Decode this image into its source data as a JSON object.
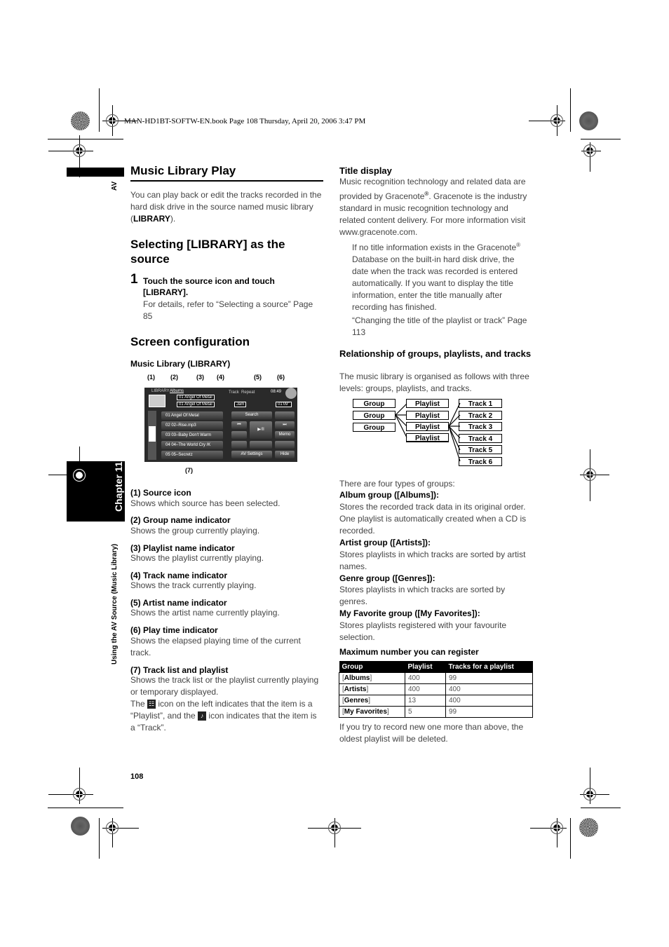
{
  "header_meta": "MAN-HD1BT-SOFTW-EN.book  Page 108  Thursday, April 20, 2006  3:47 PM",
  "side_labels": {
    "section": "AV",
    "chapter": "Chapter 11",
    "running_title": "Using the AV Source (Music Library)"
  },
  "left": {
    "title": "Music Library Play",
    "intro_pre": "You can play back or edit the tracks recorded in the hard disk drive in the source named music library (",
    "intro_bold": "LIBRARY",
    "intro_post": ").",
    "selecting_heading": "Selecting [LIBRARY] as the source",
    "step_number": "1",
    "step_text": "Touch the source icon and touch [LIBRARY].",
    "step_detail": "For details, refer to “Selecting a source” Page 85",
    "screen_heading": "Screen configuration",
    "figure_caption": "Music Library (LIBRARY)",
    "callouts": [
      "(1)",
      "(2)",
      "(3)",
      "(4)",
      "(5)",
      "(6)",
      "(7)"
    ],
    "screen": {
      "source_label": "LIBRARY",
      "group": "Albums",
      "playlist": "01 Angel Of Metal",
      "track": "01 Angel Of Metal",
      "mode_track": "Track",
      "mode_repeat": "Repeat",
      "clock": "08:49",
      "artist": "Jam",
      "time": "01'09\"",
      "tracks": [
        "01 Angel Of Metal",
        "02 02–Rise.mp3",
        "03 03–Baby Don't Warm",
        "04 04–The World Cry /K",
        "05 05–Secretz"
      ],
      "buttons": {
        "search": "Search",
        "play_pause": "▶/II",
        "prev": "⏮",
        "next": "⏭",
        "memo": "Memo",
        "av_settings": "AV Settings",
        "hide": "Hide"
      }
    },
    "items": [
      {
        "title": "(1) Source icon",
        "desc": "Shows which source has been selected."
      },
      {
        "title": "(2) Group name indicator",
        "desc": "Shows the group currently playing."
      },
      {
        "title": "(3) Playlist name indicator",
        "desc": "Shows the playlist currently playing."
      },
      {
        "title": "(4) Track name indicator",
        "desc": "Shows the track currently playing."
      },
      {
        "title": "(5) Artist name indicator",
        "desc": "Shows the artist name currently playing."
      },
      {
        "title": "(6) Play time indicator",
        "desc": "Shows the elapsed playing time of the current track."
      },
      {
        "title": "(7) Track list and playlist",
        "desc": "Shows the track list or the playlist currently playing or temporary displayed."
      }
    ],
    "icon_note_1": "The",
    "icon_note_2": "icon on the left indicates that the item is a “Playlist”, and the",
    "icon_note_3": "icon indicates that the item is a “Track”.",
    "page_number": "108"
  },
  "right": {
    "title_display_heading": "Title display",
    "title_display_pre": "Music recognition technology and related data are provided by Gracenote",
    "title_display_post": ". Gracenote is the industry standard in music recognition technology and related content delivery. For more information visit www.gracenote.com.",
    "note_pre": "If no title information exists in the Gracenote",
    "note_post": " Database on the built-in hard disk drive, the date when the track was recorded is entered automatically. If you want to display the title information, enter the title manually after recording has finished.",
    "ref": "“Changing the title of the playlist or track” Page 113",
    "relationship_heading": "Relationship of groups, playlists, and tracks",
    "relationship_text": "The music library is organised as follows with three levels: groups, playlists, and tracks.",
    "diagram": {
      "groups": [
        "Group",
        "Group",
        "Group"
      ],
      "playlists": [
        "Playlist",
        "Playlist",
        "Playlist",
        "Playlist"
      ],
      "tracks": [
        "Track 1",
        "Track 2",
        "Track 3",
        "Track 4",
        "Track 5",
        "Track 6"
      ]
    },
    "four_types": "There are four types of groups:",
    "groups": [
      {
        "title": "Album group ([Albums]):",
        "desc": "Stores the recorded track data in its original order. One playlist is automatically created when a CD is recorded."
      },
      {
        "title": "Artist group ([Artists]):",
        "desc": "Stores playlists in which tracks are sorted by artist names."
      },
      {
        "title": "Genre group ([Genres]):",
        "desc": "Stores playlists in which tracks are sorted by genres."
      },
      {
        "title": "My Favorite group ([My Favorites]):",
        "desc": "Stores playlists registered with your favourite selection."
      }
    ],
    "max_heading": "Maximum number you can register",
    "table": {
      "headers": [
        "Group",
        "Playlist",
        "Tracks for a playlist"
      ],
      "rows": [
        {
          "group": "Albums",
          "playlist": "400",
          "tracks": "99"
        },
        {
          "group": "Artists",
          "playlist": "400",
          "tracks": "400"
        },
        {
          "group": "Genres",
          "playlist": "13",
          "tracks": "400"
        },
        {
          "group": "My Favorites",
          "playlist": "5",
          "tracks": "99"
        }
      ]
    },
    "footer_note": "If you try to record new one more than above, the oldest playlist will be deleted."
  }
}
